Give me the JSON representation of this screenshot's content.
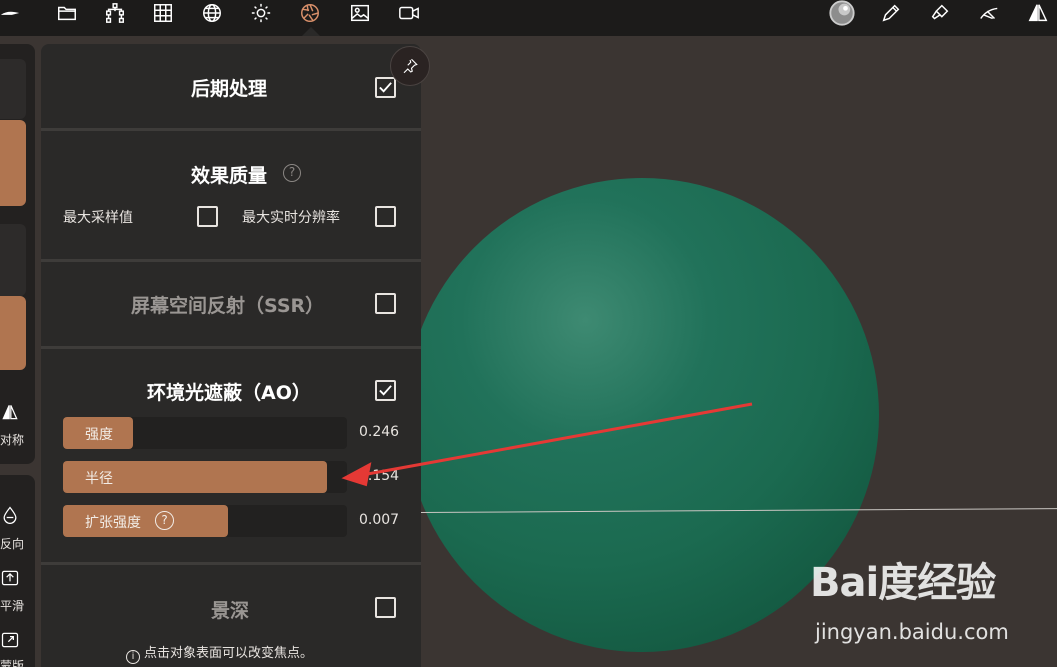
{
  "toolbar": {
    "icons": [
      "brush-stroke-icon",
      "folder-icon",
      "tree-icon",
      "grid-icon",
      "sphere-mesh-icon",
      "sun-icon",
      "aperture-icon",
      "image-icon",
      "camera-icon",
      "matcap-ball-icon",
      "pen-icon",
      "paintbrush-icon",
      "smooth-brush-icon",
      "symmetry-icon"
    ],
    "active_icon": "aperture-icon"
  },
  "left_rail": {
    "symmetry_label": "对称",
    "invert_label": "反向",
    "smooth_label": "平滑",
    "mask_label": "蒙版"
  },
  "panel": {
    "post_processing": {
      "title": "后期处理",
      "checked": true
    },
    "quality": {
      "title": "效果质量",
      "help": "?",
      "max_samples_label": "最大采样值",
      "max_samples_checked": false,
      "max_resolution_label": "最大实时分辨率",
      "max_resolution_checked": false
    },
    "ssr": {
      "title": "屏幕空间反射（SSR）",
      "checked": false
    },
    "ao": {
      "title": "环境光遮蔽（AO）",
      "checked": true,
      "sliders": [
        {
          "label": "强度",
          "value": "0.246",
          "fraction": 0.246
        },
        {
          "label": "半径",
          "value": "0.154",
          "fraction": 0.93
        },
        {
          "label": "扩张强度",
          "value": "0.007",
          "fraction": 0.58,
          "help": "?"
        }
      ]
    },
    "dof": {
      "title": "景深",
      "checked": false,
      "hint_icon": "i",
      "hint": "点击对象表面可以改变焦点。"
    }
  },
  "watermark": {
    "logo": "Bai度经验",
    "url": "jingyan.baidu.com"
  },
  "colors": {
    "accent": "#b07550",
    "sphere": "#1b6a50",
    "arrow": "#e53935",
    "panel": "#2a2928"
  }
}
